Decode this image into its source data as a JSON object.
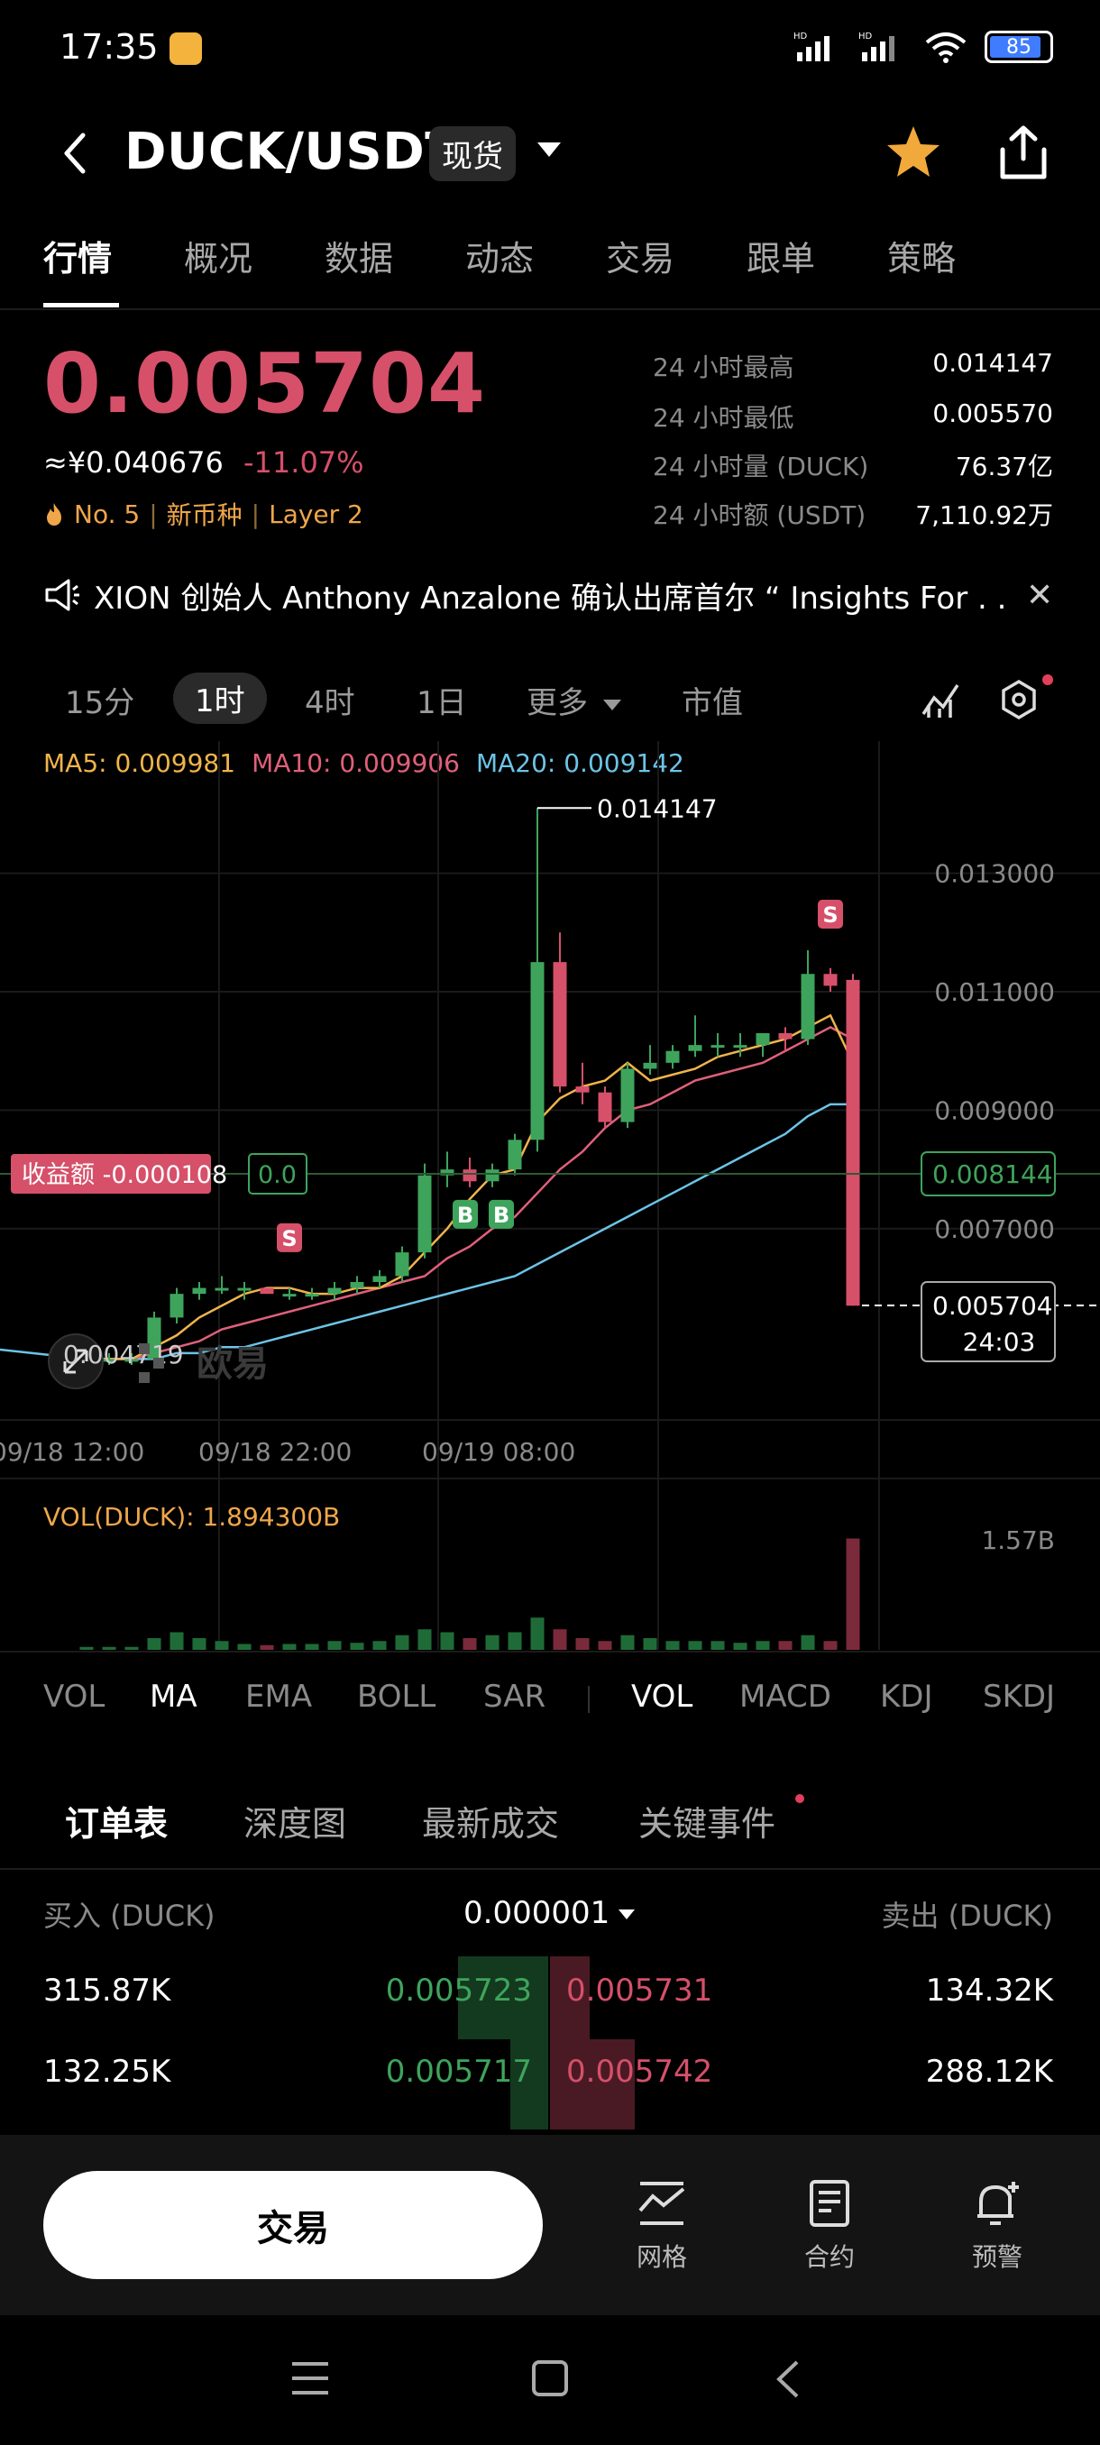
{
  "status_bar": {
    "time": "17:35",
    "battery": "85"
  },
  "header": {
    "pair": "DUCK/USDT",
    "market_type": "现货"
  },
  "tabs": [
    "行情",
    "概况",
    "数据",
    "动态",
    "交易",
    "跟单",
    "策略"
  ],
  "price": {
    "last": "0.005704",
    "cny": "≈¥0.040676",
    "change": "-11.07%",
    "rank": "No. 5",
    "tag1": "新币种",
    "tag2": "Layer 2"
  },
  "stats": [
    {
      "label": "24 小时最高",
      "value": "0.014147"
    },
    {
      "label": "24 小时最低",
      "value": "0.005570"
    },
    {
      "label": "24 小时量 (DUCK)",
      "value": "76.37亿"
    },
    {
      "label": "24 小时额 (USDT)",
      "value": "7,110.92万"
    }
  ],
  "news": {
    "text": "XION 创始人 Anthony Anzalone 确认出席首尔 “ Insights For . ."
  },
  "intervals": {
    "m15": "15分",
    "h1": "1时",
    "h4": "4时",
    "d1": "1日",
    "more": "更多",
    "market_cap": "市值"
  },
  "ma": {
    "ma5": "MA5: 0.009981",
    "ma10": "MA10: 0.009906",
    "ma20": "MA20: 0.009142"
  },
  "chart_labels": {
    "high_label": "0.014147",
    "pnl_label": "收益额 -0.000108",
    "pnl_value": "0.0",
    "ref_price": "0.008144",
    "current_price": "0.005704",
    "countdown": "24:03",
    "low_label": "0.004719",
    "watermark": "欧易",
    "y_ticks": [
      "0.013000",
      "0.011000",
      "0.009000",
      "0.007000"
    ],
    "x_ticks": [
      "09/18 12:00",
      "09/18 22:00",
      "09/19 08:00"
    ],
    "vol_label": "VOL(DUCK): 1.894300B",
    "vol_tick": "1.57B",
    "markers": {
      "sell": "S",
      "buy": "B"
    }
  },
  "chart_data": {
    "type": "candlestick",
    "ylim": [
      0.004,
      0.0145
    ],
    "candles": [
      {
        "o": 0.0048,
        "h": 0.0049,
        "l": 0.0047,
        "c": 0.0048
      },
      {
        "o": 0.0048,
        "h": 0.0049,
        "l": 0.0047,
        "c": 0.0048
      },
      {
        "o": 0.0048,
        "h": 0.0049,
        "l": 0.0047,
        "c": 0.0048
      },
      {
        "o": 0.0048,
        "h": 0.0056,
        "l": 0.0047,
        "c": 0.0055
      },
      {
        "o": 0.0055,
        "h": 0.006,
        "l": 0.0054,
        "c": 0.0059
      },
      {
        "o": 0.0059,
        "h": 0.0061,
        "l": 0.0058,
        "c": 0.006
      },
      {
        "o": 0.006,
        "h": 0.0062,
        "l": 0.0059,
        "c": 0.006
      },
      {
        "o": 0.006,
        "h": 0.0061,
        "l": 0.0058,
        "c": 0.006
      },
      {
        "o": 0.006,
        "h": 0.006,
        "l": 0.0059,
        "c": 0.0059
      },
      {
        "o": 0.0059,
        "h": 0.006,
        "l": 0.0058,
        "c": 0.0059
      },
      {
        "o": 0.0059,
        "h": 0.006,
        "l": 0.0058,
        "c": 0.0059
      },
      {
        "o": 0.0059,
        "h": 0.0061,
        "l": 0.0058,
        "c": 0.006
      },
      {
        "o": 0.006,
        "h": 0.0062,
        "l": 0.0059,
        "c": 0.0061
      },
      {
        "o": 0.0061,
        "h": 0.0063,
        "l": 0.006,
        "c": 0.0062
      },
      {
        "o": 0.0062,
        "h": 0.0067,
        "l": 0.0061,
        "c": 0.0066
      },
      {
        "o": 0.0066,
        "h": 0.0081,
        "l": 0.0065,
        "c": 0.0079
      },
      {
        "o": 0.0079,
        "h": 0.0083,
        "l": 0.0077,
        "c": 0.008
      },
      {
        "o": 0.008,
        "h": 0.0082,
        "l": 0.0077,
        "c": 0.0078
      },
      {
        "o": 0.0078,
        "h": 0.0081,
        "l": 0.0077,
        "c": 0.008
      },
      {
        "o": 0.008,
        "h": 0.0086,
        "l": 0.0079,
        "c": 0.0085
      },
      {
        "o": 0.0085,
        "h": 0.0141,
        "l": 0.0083,
        "c": 0.0115
      },
      {
        "o": 0.0115,
        "h": 0.012,
        "l": 0.0093,
        "c": 0.0094
      },
      {
        "o": 0.0094,
        "h": 0.0098,
        "l": 0.0091,
        "c": 0.0093
      },
      {
        "o": 0.0093,
        "h": 0.0094,
        "l": 0.0087,
        "c": 0.0088
      },
      {
        "o": 0.0088,
        "h": 0.0098,
        "l": 0.0087,
        "c": 0.0097
      },
      {
        "o": 0.0097,
        "h": 0.0101,
        "l": 0.0096,
        "c": 0.0098
      },
      {
        "o": 0.0098,
        "h": 0.0101,
        "l": 0.0097,
        "c": 0.01
      },
      {
        "o": 0.01,
        "h": 0.0106,
        "l": 0.0099,
        "c": 0.0101
      },
      {
        "o": 0.0101,
        "h": 0.0103,
        "l": 0.0099,
        "c": 0.0101
      },
      {
        "o": 0.0101,
        "h": 0.0103,
        "l": 0.0099,
        "c": 0.0101
      },
      {
        "o": 0.0101,
        "h": 0.0103,
        "l": 0.0099,
        "c": 0.0103
      },
      {
        "o": 0.0103,
        "h": 0.0104,
        "l": 0.01,
        "c": 0.0102
      },
      {
        "o": 0.0102,
        "h": 0.0117,
        "l": 0.0101,
        "c": 0.0113
      },
      {
        "o": 0.0113,
        "h": 0.0114,
        "l": 0.011,
        "c": 0.0111
      },
      {
        "o": 0.0112,
        "h": 0.0113,
        "l": 0.0057,
        "c": 0.0057
      }
    ],
    "ma5": [
      0.0048,
      0.0048,
      0.0048,
      0.005,
      0.0052,
      0.0055,
      0.0057,
      0.0059,
      0.006,
      0.006,
      0.0059,
      0.0059,
      0.006,
      0.006,
      0.0062,
      0.0066,
      0.007,
      0.0075,
      0.0079,
      0.008,
      0.0088,
      0.0092,
      0.0094,
      0.0095,
      0.0098,
      0.0095,
      0.0096,
      0.0097,
      0.0099,
      0.01,
      0.0101,
      0.0102,
      0.0104,
      0.0106,
      0.0098
    ],
    "ma10": [
      0.0048,
      0.0048,
      0.0048,
      0.0049,
      0.005,
      0.0051,
      0.0053,
      0.0054,
      0.0055,
      0.0056,
      0.0057,
      0.0058,
      0.0059,
      0.006,
      0.0061,
      0.0062,
      0.0065,
      0.0067,
      0.007,
      0.0072,
      0.0076,
      0.008,
      0.0083,
      0.0087,
      0.009,
      0.0091,
      0.0093,
      0.0095,
      0.0096,
      0.0097,
      0.0098,
      0.01,
      0.0102,
      0.0104,
      0.0102
    ],
    "ma20": [
      0.0048,
      0.0048,
      0.0048,
      0.0048,
      0.0049,
      0.0049,
      0.005,
      0.005,
      0.0051,
      0.0052,
      0.0053,
      0.0054,
      0.0055,
      0.0056,
      0.0057,
      0.0058,
      0.0059,
      0.006,
      0.0061,
      0.0062,
      0.0064,
      0.0066,
      0.0068,
      0.007,
      0.0072,
      0.0074,
      0.0076,
      0.0078,
      0.008,
      0.0082,
      0.0084,
      0.0086,
      0.0089,
      0.0091,
      0.0091
    ],
    "volume": [
      0.05,
      0.05,
      0.05,
      0.2,
      0.3,
      0.2,
      0.15,
      0.1,
      0.08,
      0.1,
      0.1,
      0.15,
      0.12,
      0.15,
      0.25,
      0.35,
      0.3,
      0.2,
      0.25,
      0.3,
      0.55,
      0.35,
      0.2,
      0.15,
      0.25,
      0.2,
      0.15,
      0.15,
      0.15,
      0.12,
      0.15,
      0.15,
      0.25,
      0.15,
      1.9
    ]
  },
  "indicators_main": [
    "VOL",
    "MA",
    "EMA",
    "BOLL",
    "SAR"
  ],
  "indicators_sub": [
    "VOL",
    "MACD",
    "KDJ",
    "SKDJ"
  ],
  "order_tabs": [
    "订单表",
    "深度图",
    "最新成交",
    "关键事件"
  ],
  "orderbook": {
    "buy_header": "买入 (DUCK)",
    "precision": "0.000001",
    "sell_header": "卖出 (DUCK)",
    "rows": [
      {
        "bid_qty": "315.87K",
        "bid": "0.005723",
        "ask": "0.005731",
        "ask_qty": "134.32K"
      },
      {
        "bid_qty": "132.25K",
        "bid": "0.005717",
        "ask": "0.005742",
        "ask_qty": "288.12K"
      }
    ]
  },
  "actions": {
    "trade": "交易",
    "grid": "网格",
    "contract": "合约",
    "alert": "预警"
  },
  "colors": {
    "up": "#3ea45c",
    "down": "#d6506a",
    "ma5": "#f0b44a",
    "ma10": "#e0607a",
    "ma20": "#6cc4e6"
  }
}
